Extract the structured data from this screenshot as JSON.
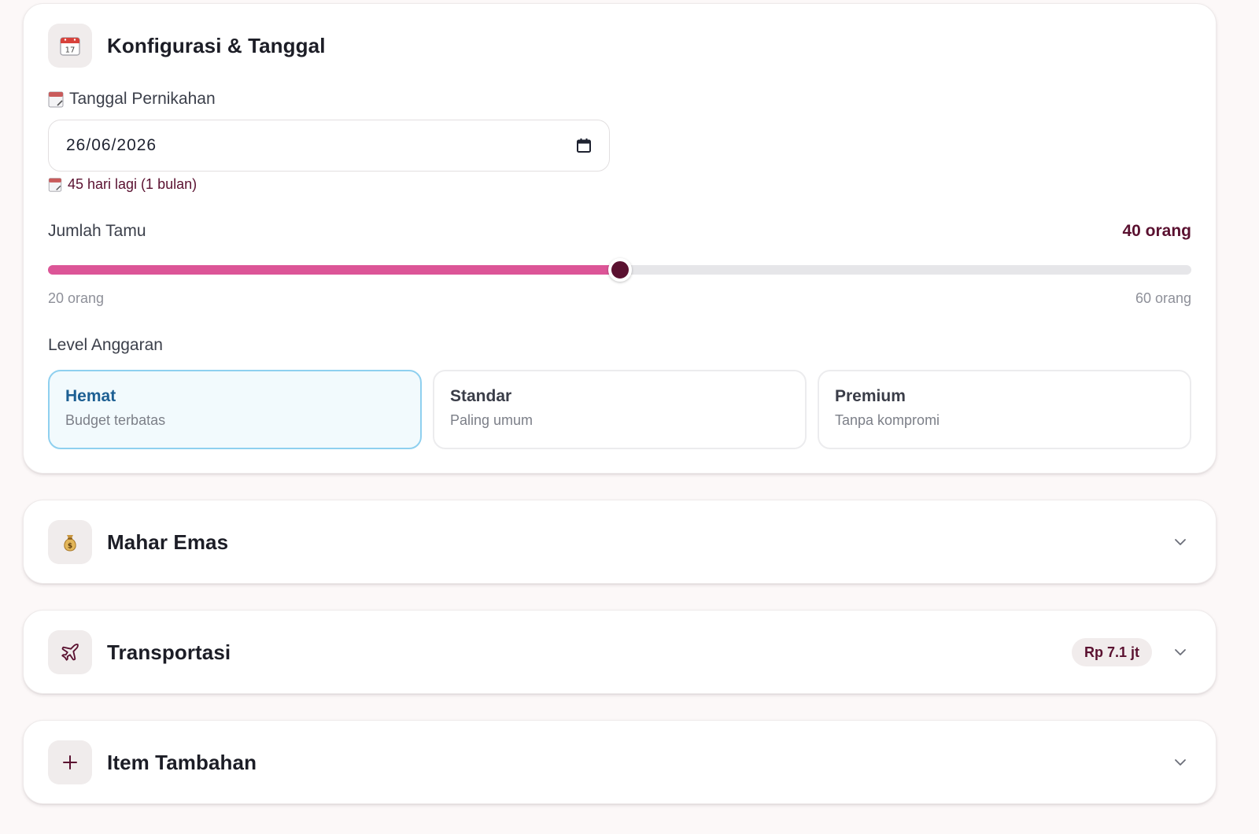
{
  "config_card": {
    "title": "Konfigurasi & Tanggal",
    "icon": "calendar-icon",
    "icon_day": "17",
    "date_label": "Tanggal Pernikahan",
    "date_value": "26/06/2026",
    "countdown": "45 hari lagi (1 bulan)",
    "guests_label": "Jumlah Tamu",
    "guests_value": "40 orang",
    "guests_min_label": "20 orang",
    "guests_max_label": "60 orang",
    "guests": {
      "min": 20,
      "max": 60,
      "value": 40
    },
    "budget_label": "Level Anggaran",
    "budget_options": [
      {
        "title": "Hemat",
        "subtitle": "Budget terbatas",
        "selected": true
      },
      {
        "title": "Standar",
        "subtitle": "Paling umum",
        "selected": false
      },
      {
        "title": "Premium",
        "subtitle": "Tanpa kompromi",
        "selected": false
      }
    ]
  },
  "sections": [
    {
      "title": "Mahar Emas",
      "icon": "money-bag-icon",
      "badge": ""
    },
    {
      "title": "Transportasi",
      "icon": "plane-icon",
      "badge": "Rp 7.1 jt"
    },
    {
      "title": "Item Tambahan",
      "icon": "plus-icon",
      "badge": ""
    }
  ],
  "colors": {
    "accent": "#5a1130",
    "slider_fill": "#dc5597",
    "selected_border": "#8fd0ef",
    "selected_title": "#1d5f93"
  }
}
